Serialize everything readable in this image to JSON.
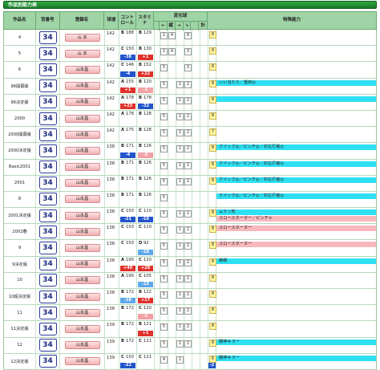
{
  "title": "作品別能力表",
  "headers": {
    "work": "作品名",
    "number": "背番号",
    "registered_name": "登録名",
    "speed": "球速",
    "control": "コントロール",
    "stamina": "スタミナ",
    "breaking_balls": "変化球",
    "break_dirs": [
      "←",
      "縦",
      "→",
      "↘",
      "計"
    ],
    "abilities": "特殊能力"
  },
  "rows": [
    {
      "work": "4",
      "number": "34",
      "name": "山 本",
      "speed": "142",
      "control_grade": "B",
      "control": "188",
      "control_delta": "",
      "control_color": "",
      "stamina_grade": "B",
      "stamina": "129",
      "stamina_delta": "",
      "stamina_color": "",
      "changes": [
        "2",
        "4",
        "",
        "8",
        "",
        ""
      ],
      "total": "8",
      "total_delta": "",
      "abilities": []
    },
    {
      "work": "5",
      "number": "34",
      "name": "山 本",
      "speed": "142",
      "control_grade": "C",
      "control": "150",
      "control_delta": "-38",
      "control_color": "blue",
      "stamina_grade": "B",
      "stamina": "130",
      "stamina_delta": "+1",
      "stamina_color": "red",
      "changes": [
        "2",
        "4",
        "",
        "3",
        "",
        ""
      ],
      "total": "9",
      "total_delta": "",
      "abilities": []
    },
    {
      "work": "6",
      "number": "34",
      "name": "山本昌",
      "speed": "142",
      "control_grade": "C",
      "control": "146",
      "control_delta": "-4",
      "control_color": "blue",
      "stamina_grade": "B",
      "stamina": "152",
      "stamina_delta": "+22",
      "stamina_color": "red",
      "changes": [
        "5",
        "",
        "",
        "3",
        "",
        ""
      ],
      "total": "8",
      "total_delta": "",
      "abilities": []
    },
    {
      "work": "96開幕版",
      "number": "34",
      "name": "山本昌",
      "speed": "142",
      "control_grade": "A",
      "control": "155",
      "control_delta": "+1",
      "control_color": "red",
      "stamina_grade": "B",
      "stamina": "120",
      "stamina_delta": "-1",
      "stamina_color": "pink",
      "changes": [
        "5",
        "",
        "1",
        "2",
        "",
        ""
      ],
      "total": "8",
      "total_delta": "",
      "abilities": [
        {
          "text": "いい当たり／重刺◎",
          "color": "cyan"
        }
      ]
    },
    {
      "work": "96決定版",
      "number": "34",
      "name": "山本昌",
      "speed": "142",
      "control_grade": "A",
      "control": "178",
      "control_delta": "+23",
      "control_color": "red",
      "stamina_grade": "B",
      "stamina": "178",
      "stamina_delta": "-32",
      "stamina_color": "blue",
      "changes": [
        "5",
        "",
        "1",
        "2",
        "",
        ""
      ],
      "total": "8",
      "total_delta": "",
      "abilities": [
        {
          "text": "",
          "color": "cyan"
        }
      ]
    },
    {
      "work": "2000",
      "number": "34",
      "name": "山本昌",
      "speed": "142",
      "control_grade": "A",
      "control": "178",
      "control_delta": "",
      "control_color": "",
      "stamina_grade": "B",
      "stamina": "128",
      "stamina_delta": "",
      "stamina_color": "",
      "changes": [
        "5",
        "",
        "1",
        "2",
        "",
        ""
      ],
      "total": "8",
      "total_delta": "",
      "abilities": []
    },
    {
      "work": "2000開幕版",
      "number": "34",
      "name": "山本昌",
      "speed": "142",
      "control_grade": "A",
      "control": "175",
      "control_delta": "",
      "control_color": "",
      "stamina_grade": "B",
      "stamina": "128",
      "stamina_delta": "",
      "stamina_color": "",
      "changes": [
        "5",
        "",
        "1",
        "2",
        "",
        ""
      ],
      "total": "7",
      "total_delta": "",
      "abilities": []
    },
    {
      "work": "2000決定版",
      "number": "34",
      "name": "山本昌",
      "speed": "138",
      "control_grade": "B",
      "control": "171",
      "control_delta": "-4",
      "control_color": "blue",
      "stamina_grade": "B",
      "stamina": "126",
      "stamina_delta": "-2",
      "stamina_color": "pink",
      "changes": [
        "5",
        "",
        "1",
        "2",
        "",
        ""
      ],
      "total": "8",
      "total_delta": "",
      "abilities": [
        {
          "text": "クイック◎／ピンチ◎／対左打者◎",
          "color": "cyan"
        }
      ]
    },
    {
      "work": "Basic2001",
      "number": "34",
      "name": "山本昌",
      "speed": "138",
      "control_grade": "B",
      "control": "171",
      "control_delta": "",
      "control_color": "",
      "stamina_grade": "B",
      "stamina": "126",
      "stamina_delta": "",
      "stamina_color": "",
      "changes": [
        "5",
        "",
        "1",
        "2",
        "",
        ""
      ],
      "total": "8",
      "total_delta": "",
      "abilities": [
        {
          "text": "クイック◎／ピンチ◎／対左打者◎",
          "color": "cyan"
        }
      ]
    },
    {
      "work": "2001",
      "number": "34",
      "name": "山本昌",
      "speed": "138",
      "control_grade": "B",
      "control": "171",
      "control_delta": "",
      "control_color": "",
      "stamina_grade": "B",
      "stamina": "126",
      "stamina_delta": "",
      "stamina_color": "",
      "changes": [
        "5",
        "",
        "1",
        "2",
        "",
        ""
      ],
      "total": "8",
      "total_delta": "",
      "abilities": [
        {
          "text": "クイック◎／ピンチ◎／対左打者◎",
          "color": "cyan"
        }
      ]
    },
    {
      "work": "8",
      "number": "34",
      "name": "山本昌",
      "speed": "138",
      "control_grade": "B",
      "control": "171",
      "control_delta": "",
      "control_color": "",
      "stamina_grade": "B",
      "stamina": "126",
      "stamina_delta": "",
      "stamina_color": "",
      "changes": [
        "5",
        "",
        "",
        "",
        "",
        ""
      ],
      "total": "",
      "total_delta": "",
      "abilities": [
        {
          "text": "クイック◎／ピンチ◎／対左打者◎",
          "color": "cyan"
        }
      ]
    },
    {
      "work": "2001決定版",
      "number": "34",
      "name": "山本昌",
      "speed": "138",
      "control_grade": "C",
      "control": "150",
      "control_delta": "-21",
      "control_color": "blue",
      "stamina_grade": "C",
      "stamina": "110",
      "stamina_delta": "-16",
      "stamina_color": "blue",
      "changes": [
        "5",
        "",
        "1",
        "2",
        "",
        ""
      ],
      "total": "8",
      "total_delta": "",
      "abilities": [
        {
          "text": "ムラっ気",
          "color": "cyan"
        },
        {
          "text": "スロースターター／ピンチ×",
          "color": "pink"
        }
      ]
    },
    {
      "work": "2002春",
      "number": "34",
      "name": "山本昌",
      "speed": "138",
      "control_grade": "C",
      "control": "150",
      "control_delta": "",
      "control_color": "",
      "stamina_grade": "C",
      "stamina": "110",
      "stamina_delta": "",
      "stamina_color": "",
      "changes": [
        "5",
        "",
        "1",
        "2",
        "",
        ""
      ],
      "total": "8",
      "total_delta": "",
      "abilities": [
        {
          "text": "スロースターター",
          "color": "pink"
        }
      ]
    },
    {
      "work": "9",
      "number": "34",
      "name": "山本昌",
      "speed": "138",
      "control_grade": "C",
      "control": "150",
      "control_delta": "",
      "control_color": "",
      "stamina_grade": "D",
      "stamina": "92",
      "stamina_delta": "-18",
      "stamina_color": "lblue",
      "changes": [
        "5",
        "",
        "1",
        "2",
        "",
        ""
      ],
      "total": "8",
      "total_delta": "",
      "abilities": [
        {
          "text": "スロースターター",
          "color": "pink"
        }
      ]
    },
    {
      "work": "9決定版",
      "number": "34",
      "name": "山本昌",
      "speed": "138",
      "control_grade": "A",
      "control": "190",
      "control_delta": "+40",
      "control_color": "red",
      "stamina_grade": "C",
      "stamina": "120",
      "stamina_delta": "+28",
      "stamina_color": "red",
      "changes": [
        "5",
        "",
        "1",
        "2",
        "",
        ""
      ],
      "total": "8",
      "total_delta": "",
      "abilities": [
        {
          "text": "勝頼",
          "color": "cyan"
        }
      ]
    },
    {
      "work": "10",
      "number": "34",
      "name": "山本昌",
      "speed": "138",
      "control_grade": "A",
      "control": "190",
      "control_delta": "",
      "control_color": "",
      "stamina_grade": "C",
      "stamina": "105",
      "stamina_delta": "-15",
      "stamina_color": "lblue",
      "changes": [
        "5",
        "",
        "1",
        "2",
        "",
        ""
      ],
      "total": "8",
      "total_delta": "",
      "abilities": []
    },
    {
      "work": "10超決定版",
      "number": "34",
      "name": "山本昌",
      "speed": "138",
      "control_grade": "B",
      "control": "172",
      "control_delta": "-18",
      "control_color": "lblue",
      "stamina_grade": "B",
      "stamina": "122",
      "stamina_delta": "+17",
      "stamina_color": "red",
      "changes": [
        "5",
        "",
        "1",
        "2",
        "",
        ""
      ],
      "total": "8",
      "total_delta": "",
      "abilities": []
    },
    {
      "work": "11",
      "number": "34",
      "name": "山本昌",
      "speed": "138",
      "control_grade": "B",
      "control": "172",
      "control_delta": "",
      "control_color": "",
      "stamina_grade": "C",
      "stamina": "120",
      "stamina_delta": "-2",
      "stamina_color": "pink",
      "changes": [
        "5",
        "",
        "1",
        "2",
        "",
        ""
      ],
      "total": "8",
      "total_delta": "",
      "abilities": []
    },
    {
      "work": "11決定版",
      "number": "34",
      "name": "山本昌",
      "speed": "139",
      "control_grade": "B",
      "control": "172",
      "control_delta": "",
      "control_color": "",
      "stamina_grade": "B",
      "stamina": "121",
      "stamina_delta": "+1",
      "stamina_color": "red",
      "changes": [
        "5",
        "",
        "1",
        "2",
        "",
        ""
      ],
      "total": "8",
      "total_delta": "",
      "abilities": []
    },
    {
      "work": "12",
      "number": "34",
      "name": "山本昌",
      "speed": "139",
      "control_grade": "B",
      "control": "172",
      "control_delta": "",
      "control_color": "",
      "stamina_grade": "C",
      "stamina": "121",
      "stamina_delta": "",
      "stamina_color": "",
      "changes": [
        "5",
        "",
        "1",
        "2",
        "",
        ""
      ],
      "total": "8",
      "total_delta": "",
      "abilities": [
        {
          "text": "勝神キラー",
          "color": "cyan"
        }
      ]
    },
    {
      "work": "12決定版",
      "number": "34",
      "name": "山本昌",
      "speed": "139",
      "control_grade": "C",
      "control": "150",
      "control_delta": "-22",
      "control_color": "blue",
      "stamina_grade": "C",
      "stamina": "121",
      "stamina_delta": "",
      "stamina_color": "",
      "changes": [
        "4",
        "",
        "1",
        "",
        "",
        ""
      ],
      "total": "6",
      "total_delta": "-2",
      "abilities": [
        {
          "text": "勝神キラー",
          "color": "cyan"
        }
      ]
    }
  ],
  "colors": {
    "header_bg": "#9fd4a6",
    "title_bg": "#177a26",
    "delta_red": "#e0312b",
    "delta_blue": "#2255cc",
    "ability_cyan": "#2fe0f2",
    "ability_pink": "#f8b8bd"
  }
}
